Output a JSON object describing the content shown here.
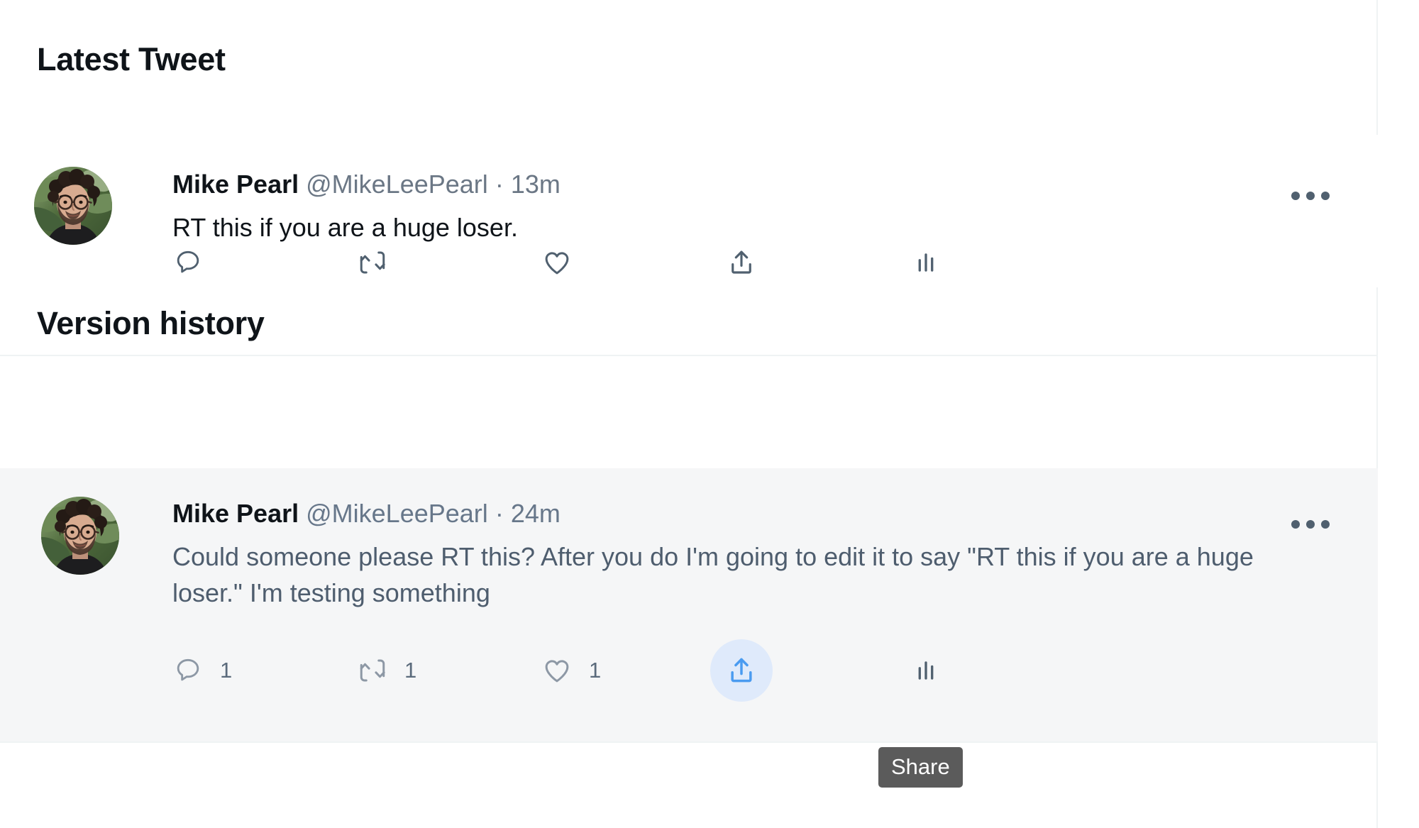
{
  "app": {
    "platform": "twitter",
    "accent_color": "#4a9bf0",
    "share_hover_bg": "#dfeafb",
    "tooltip_bg": "#5b5b5b",
    "highlight_row_bg": "#f5f6f7",
    "divider_color": "#eff3f4",
    "text_primary": "#0f1419",
    "text_secondary": "#6b7785",
    "text_muted_body": "#4e5d6e"
  },
  "sections": {
    "latest_tweet_heading": "Latest Tweet",
    "version_history_heading": "Version history"
  },
  "tweets": {
    "latest": {
      "display_name": "Mike Pearl",
      "handle": "@MikeLeePearl",
      "separator": "·",
      "timestamp": "13m",
      "text": "RT this if you are a huge loser.",
      "avatar_alt": "Mike Pearl profile photo",
      "more_label": "More",
      "actions": [
        {
          "name": "reply",
          "icon": "reply-icon",
          "count": ""
        },
        {
          "name": "retweet",
          "icon": "retweet-icon",
          "count": ""
        },
        {
          "name": "like",
          "icon": "heart-icon",
          "count": ""
        },
        {
          "name": "share",
          "icon": "share-icon",
          "count": ""
        },
        {
          "name": "views",
          "icon": "analytics-icon",
          "count": ""
        }
      ]
    },
    "version": {
      "display_name": "Mike Pearl",
      "handle": "@MikeLeePearl",
      "separator": "·",
      "timestamp": "24m",
      "text": "Could someone please RT this? After you do I'm going to edit it to say \"RT this if you are a huge loser.\" I'm testing something",
      "avatar_alt": "Mike Pearl profile photo",
      "more_label": "More",
      "actions": [
        {
          "name": "reply",
          "icon": "reply-icon",
          "count": "1"
        },
        {
          "name": "retweet",
          "icon": "retweet-icon",
          "count": "1"
        },
        {
          "name": "like",
          "icon": "heart-icon",
          "count": "1"
        },
        {
          "name": "share",
          "icon": "share-icon",
          "count": ""
        },
        {
          "name": "views",
          "icon": "analytics-icon",
          "count": ""
        }
      ]
    }
  },
  "tooltip": {
    "share_label": "Share"
  }
}
